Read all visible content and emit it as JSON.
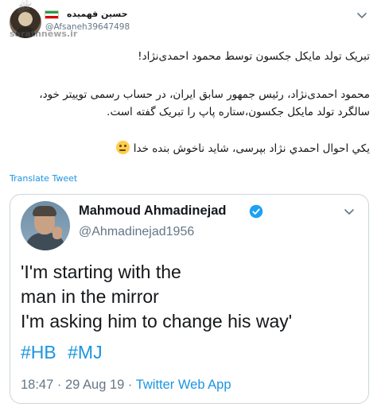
{
  "outer_tweet": {
    "author_name": "حسین فهمیده",
    "handle": "@Afsaneh39647498",
    "watermark": "sarathnews.ir",
    "flag_colors": [
      "#239f40",
      "#ffffff",
      "#da0000"
    ],
    "paragraphs": [
      "تبریک تولد مایکل جکسون توسط محمود احمدی‌نژاد!",
      "محمود احمدی‌نژاد، رئیس جمهور سابق ایران، در حساب رسمی توییتر خود، سالگرد تولد مایکل جکسون،ستاره پاپ را تبریک گفته است.",
      "يکي احوال احمدي نژاد بپرسی، شاید ناخوش بنده خدا"
    ],
    "emoji": "thinking-face-icon",
    "translate_label": "Translate Tweet"
  },
  "quoted_tweet": {
    "author_name": "Mahmoud Ahmadinejad",
    "handle": "@Ahmadinejad1956",
    "text_lines": [
      "'I'm starting with the",
      "man in the mirror",
      "I'm asking him to change his way'"
    ],
    "hashtags": [
      "#HB",
      "#MJ"
    ],
    "time": "18:47",
    "separator": "·",
    "date": "29 Aug 19",
    "app": "Twitter Web App"
  },
  "colors": {
    "link": "#1b95e0",
    "secondary_text": "#657786",
    "border": "#ccd6dd",
    "verified": "#1da1f2"
  }
}
